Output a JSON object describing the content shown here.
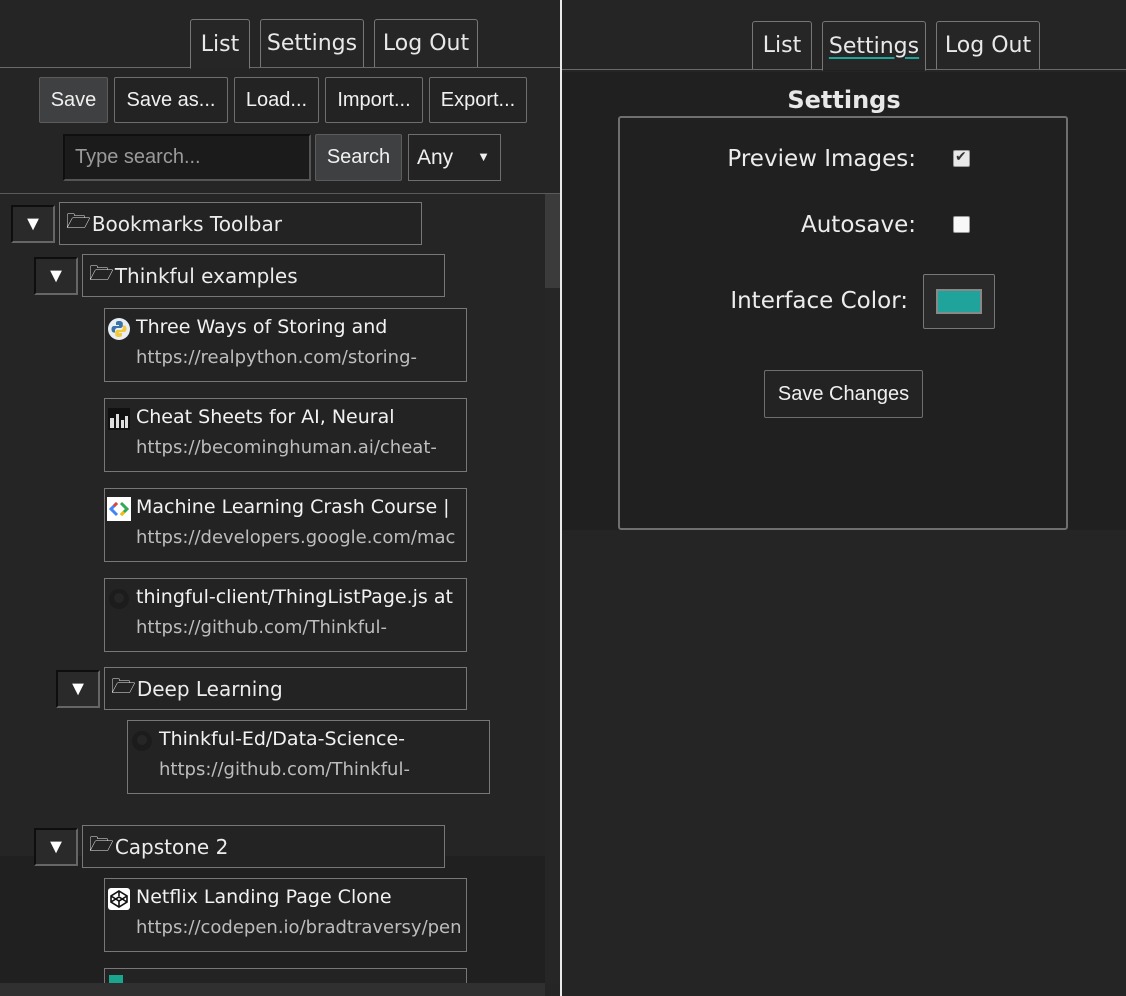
{
  "colors": {
    "accent": "#20a39a",
    "background": "#252526"
  },
  "left": {
    "tabs": [
      {
        "label": "List",
        "active": true
      },
      {
        "label": "Settings",
        "active": false
      },
      {
        "label": "Log Out",
        "active": false
      }
    ],
    "toolbar": {
      "save": "Save",
      "save_as": "Save as...",
      "load": "Load...",
      "import": "Import...",
      "export": "Export..."
    },
    "search": {
      "placeholder": "Type search...",
      "button": "Search",
      "filter_value": "Any"
    },
    "tree": {
      "bookmarks_toolbar": "Bookmarks Toolbar",
      "thinkful_examples": "Thinkful examples",
      "bookmarks": [
        {
          "title": "Three Ways of Storing and",
          "url": "https://realpython.com/storing-",
          "icon": "python-icon"
        },
        {
          "title": "Cheat Sheets for AI, Neural",
          "url": "https://becominghuman.ai/cheat-",
          "icon": "becominghuman-icon"
        },
        {
          "title": "Machine Learning Crash Course  |",
          "url": "https://developers.google.com/mac",
          "icon": "google-developers-icon"
        },
        {
          "title": "thingful-client/ThingListPage.js at",
          "url": "https://github.com/Thinkful-",
          "icon": "github-icon"
        }
      ],
      "deep_learning": "Deep Learning",
      "deep_learning_items": [
        {
          "title": "Thinkful-Ed/Data-Science-",
          "url": "https://github.com/Thinkful-",
          "icon": "github-icon"
        }
      ],
      "capstone": "Capstone 2",
      "capstone_items": [
        {
          "title": "Netflix Landing Page Clone",
          "url": "https://codepen.io/bradtraversy/pen",
          "icon": "codepen-icon"
        }
      ],
      "toggle_symbol": "▼",
      "folder_symbol": "🗁"
    }
  },
  "right": {
    "tabs": [
      {
        "label": "List",
        "active": false
      },
      {
        "label": "Settings",
        "active": true
      },
      {
        "label": "Log Out",
        "active": false
      }
    ],
    "settings": {
      "title": "Settings",
      "preview_images_label": "Preview Images:",
      "preview_images_checked": true,
      "autosave_label": "Autosave:",
      "autosave_checked": false,
      "interface_color_label": "Interface Color:",
      "interface_color": "#20a39a",
      "save_changes": "Save Changes"
    }
  }
}
